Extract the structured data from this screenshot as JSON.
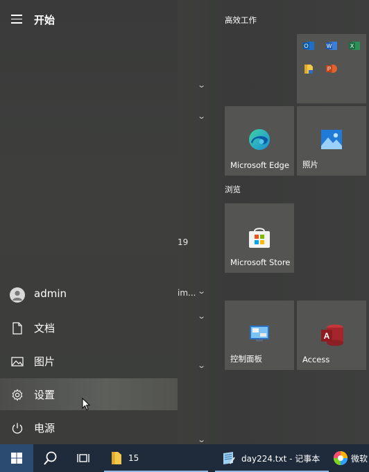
{
  "start_menu": {
    "title": "开始",
    "nav_items": [
      {
        "label": "admin"
      },
      {
        "label": "文档"
      },
      {
        "label": "图片"
      },
      {
        "label": "设置"
      },
      {
        "label": "电源"
      }
    ]
  },
  "app_list": {
    "partial_text_1": "19",
    "partial_text_2": "im..."
  },
  "tiles": {
    "group_productivity": "高效工作",
    "group_browse": "浏览",
    "edge_label": "Microsoft Edge",
    "photos_label": "照片",
    "store_label": "Microsoft Store",
    "control_panel_label": "控制面板",
    "access_label": "Access"
  },
  "taskbar": {
    "folder_count": "15",
    "notepad_label": "day224.txt - 记事本",
    "wechat_label": "微软"
  },
  "colors": {
    "accent": "#2c4b70",
    "taskbar": "#1f2a3a",
    "tile": "#545553"
  }
}
